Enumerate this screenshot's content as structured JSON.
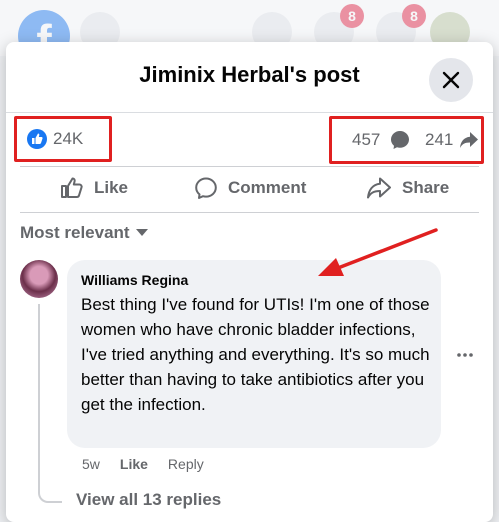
{
  "topnav": {
    "logo": "f",
    "badges": [
      "8",
      "8"
    ]
  },
  "modal": {
    "title": "Jiminix Herbal's post",
    "close_icon": "close-icon"
  },
  "counts": {
    "likes": "24K",
    "comments": "457",
    "shares": "241"
  },
  "actions": {
    "like": "Like",
    "comment": "Comment",
    "share": "Share"
  },
  "sort_label": "Most relevant",
  "comment": {
    "author": "Williams Regina",
    "text": "Best thing I've found for UTIs! I'm one of those women who have chronic bladder infections, I've tried anything and everything. It's so much better than having to take antibiotics after you get the infection.",
    "time": "5w",
    "like_label": "Like",
    "reply_label": "Reply"
  },
  "view_replies": "View all 13 replies",
  "colors": {
    "brand": "#1877f2",
    "annotation": "#e02020",
    "badge": "#e41e3f"
  }
}
